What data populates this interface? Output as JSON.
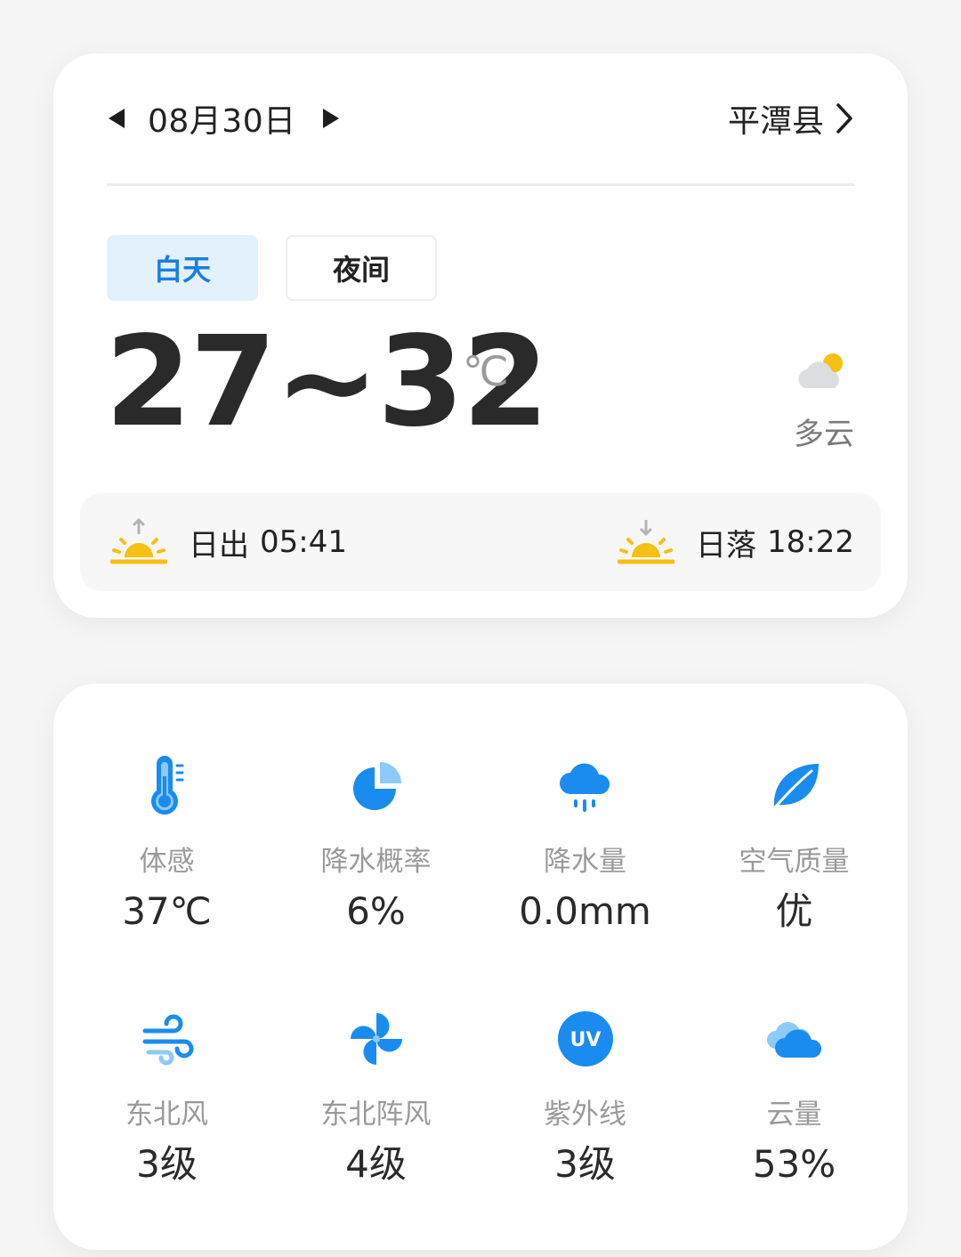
{
  "header": {
    "date": "08月30日",
    "location": "平潭县"
  },
  "tabs": [
    {
      "label": "白天",
      "active": true
    },
    {
      "label": "夜间",
      "active": false
    }
  ],
  "forecast": {
    "temp_range": "27~32",
    "unit": "℃",
    "condition": "多云",
    "condition_icon": "partly-cloudy-icon"
  },
  "sun": {
    "sunrise_label": "日出",
    "sunrise_time": "05:41",
    "sunset_label": "日落",
    "sunset_time": "18:22"
  },
  "details": [
    {
      "icon": "thermometer-icon",
      "label": "体感",
      "value": "37℃"
    },
    {
      "icon": "pie-chart-icon",
      "label": "降水概率",
      "value": "6%"
    },
    {
      "icon": "rain-cloud-icon",
      "label": "降水量",
      "value": "0.0mm"
    },
    {
      "icon": "leaf-icon",
      "label": "空气质量",
      "value": "优"
    },
    {
      "icon": "wind-icon",
      "label": "东北风",
      "value": "3级"
    },
    {
      "icon": "pinwheel-icon",
      "label": "东北阵风",
      "value": "4级"
    },
    {
      "icon": "uv-icon",
      "label": "紫外线",
      "value": "3级",
      "badge": "UV"
    },
    {
      "icon": "cloud-icon",
      "label": "云量",
      "value": "53%"
    }
  ],
  "colors": {
    "accent": "#1a7fe0",
    "icon_blue": "#1a8cf0",
    "sun_yellow": "#f7c012",
    "tab_active_bg": "#e3f1fd"
  }
}
